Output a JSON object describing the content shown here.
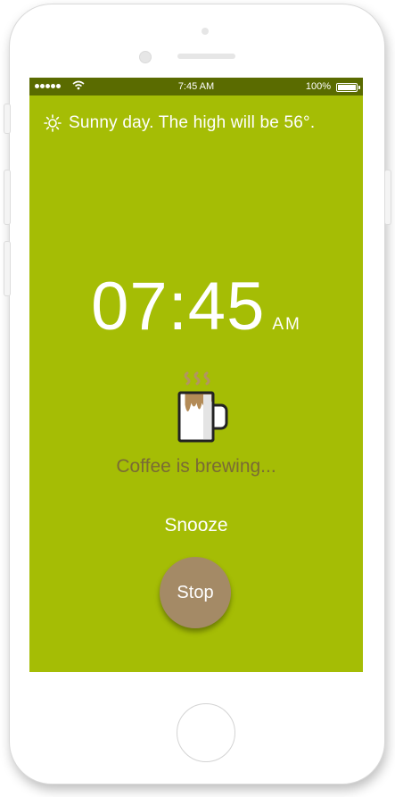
{
  "status_bar": {
    "time": "7:45 AM",
    "battery": "100%"
  },
  "weather": {
    "icon": "sun-icon",
    "text": "Sunny day. The high will be 56°."
  },
  "alarm": {
    "time": "07:45",
    "period": "AM"
  },
  "brew": {
    "icon": "coffee-mug-icon",
    "status": "Coffee is brewing..."
  },
  "actions": {
    "snooze_label": "Snooze",
    "stop_label": "Stop"
  },
  "colors": {
    "screen_bg": "#a5bd05",
    "status_bar_bg": "#5a6b00",
    "stop_button": "#a48a66",
    "brew_text": "#7a6b35"
  }
}
